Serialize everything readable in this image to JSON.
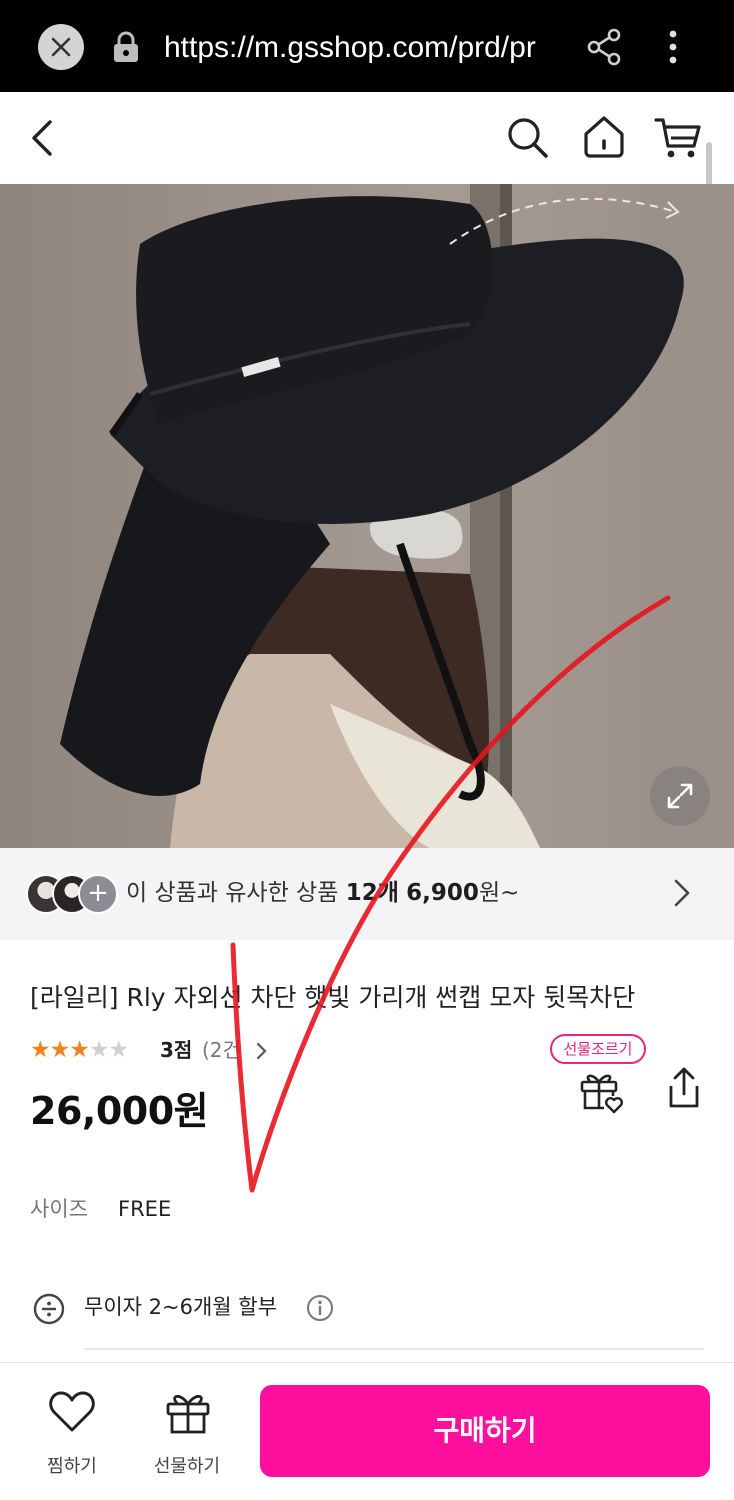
{
  "browser": {
    "url": "https://m.gsshop.com/prd/pr"
  },
  "similar": {
    "plus": "+",
    "text_prefix": "이 상품과 유사한 상품 ",
    "count": "12개",
    "price_from": "6,900",
    "suffix": "원~"
  },
  "product": {
    "title": "[라일리] Rly 자외선 차단 햇빛 가리개 썬캡 모자 뒷목차단",
    "stars_on": "★★★",
    "stars_off": "★★",
    "rating_score": "3점",
    "rating_count": "(2건",
    "price": "26,000원",
    "gift_badge": "선물조르기",
    "size_label": "사이즈",
    "size_value": "FREE",
    "installment": "무이자 2~6개월 할부"
  },
  "bottom": {
    "wish_label": "찜하기",
    "gift_label": "선물하기",
    "buy_label": "구매하기"
  },
  "colors": {
    "accent": "#ff0f9e",
    "badge": "#e6277e",
    "star": "#f3821f",
    "annotation": "#e8141e"
  }
}
